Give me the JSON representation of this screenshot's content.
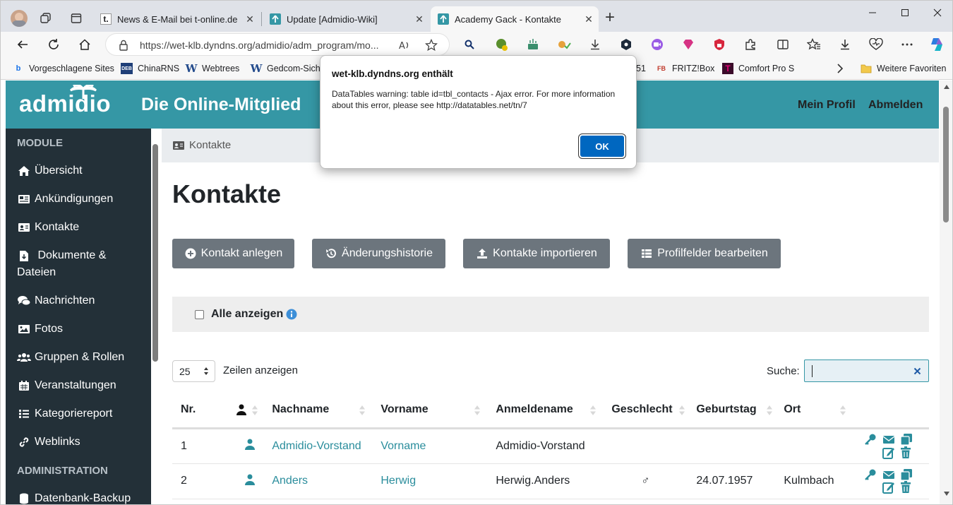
{
  "browser": {
    "tabs": [
      {
        "title": "News & E-Mail bei t-online.de | F",
        "close": "✕"
      },
      {
        "title": "Update [Admidio-Wiki]",
        "close": "✕"
      },
      {
        "title": "Academy Gack - Kontakte",
        "close": "✕"
      }
    ],
    "new_tab": "+",
    "url": "https://wet-klb.dyndns.org/admidio/adm_program/mo...",
    "favorites": [
      {
        "label": "Vorgeschlagene Sites"
      },
      {
        "label": "ChinaRNS"
      },
      {
        "label": "Webtrees"
      },
      {
        "label": "Gedcom-Siche"
      },
      {
        "label": "51"
      },
      {
        "label": "FRITZ!Box"
      },
      {
        "label": "Comfort Pro S"
      },
      {
        "label": "Weitere Favoriten"
      }
    ]
  },
  "dialog": {
    "title": "wet-klb.dyndns.org enthält",
    "message": "DataTables warning: table id=tbl_contacts - Ajax error. For more information about this error, please see http://datatables.net/tn/7",
    "ok_label": "OK"
  },
  "header": {
    "logo": "admidio",
    "headline": "Die Online-Mitglied",
    "nav": [
      "Mein Profil",
      "Abmelden"
    ]
  },
  "sidebar": {
    "section1": "MODULE",
    "items": [
      "Übersicht",
      "Ankündigungen",
      "Kontakte",
      "Dokumente &",
      "Dateien",
      "Nachrichten",
      "Fotos",
      "Gruppen & Rollen",
      "Veranstaltungen",
      "Kategoriereport",
      "Weblinks"
    ],
    "section2": "ADMINISTRATION",
    "admin_items": [
      "Datenbank-Backup"
    ]
  },
  "main": {
    "breadcrumb": "Kontakte",
    "title": "Kontakte",
    "buttons": [
      "Kontakt anlegen",
      "Änderungshistorie",
      "Kontakte importieren",
      "Profilfelder bearbeiten"
    ],
    "show_all_label": "Alle anzeigen",
    "page_length": "25",
    "page_length_suffix": "Zeilen anzeigen",
    "search_label": "Suche:",
    "search_value": "",
    "columns": [
      "Nr.",
      "",
      "Nachname",
      "Vorname",
      "Anmeldename",
      "Geschlecht",
      "Geburtstag",
      "Ort",
      ""
    ],
    "rows": [
      {
        "nr": "1",
        "nachname": "Admidio-Vorstand",
        "vorname": "Vorname",
        "login": "Admidio-Vorstand",
        "gender": "",
        "birthday": "",
        "ort": ""
      },
      {
        "nr": "2",
        "nachname": "Anders",
        "vorname": "Herwig",
        "login": "Herwig.Anders",
        "gender": "♂",
        "birthday": "24.07.1957",
        "ort": "Kulmbach"
      }
    ]
  },
  "colors": {
    "accent": "#3597a5",
    "sidebar": "#233038",
    "button": "#6c757d"
  }
}
